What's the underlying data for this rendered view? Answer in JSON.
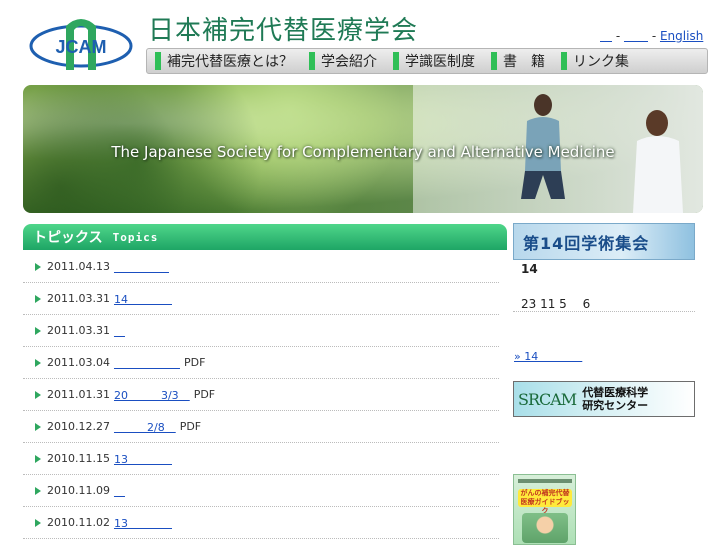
{
  "header": {
    "logo_text": "JCAM",
    "site_title": "日本補完代替医療学会",
    "lang_links": [
      "＿",
      "＿＿",
      "English"
    ],
    "lang_separator": " - "
  },
  "nav": {
    "items": [
      {
        "label": "補完代替医療とは？"
      },
      {
        "label": "学会紹介"
      },
      {
        "label": "学識医制度"
      },
      {
        "label": "書　籍"
      },
      {
        "label": "リンク集"
      }
    ]
  },
  "banner": {
    "text": "The Japanese Society for Complementary and Alternative Medicine"
  },
  "topics": {
    "title_jp": "トピックス",
    "title_en": "Topics",
    "items": [
      {
        "date": "2011.04.13",
        "link": "＿＿＿＿＿",
        "tail": ""
      },
      {
        "date": "2011.03.31",
        "link": "14＿＿＿＿",
        "tail": ""
      },
      {
        "date": "2011.03.31",
        "link": "＿",
        "tail": ""
      },
      {
        "date": "2011.03.04",
        "link": "＿＿＿＿＿＿",
        "tail": "PDF"
      },
      {
        "date": "2011.01.31",
        "link": "20＿＿＿3/3＿",
        "tail": "PDF"
      },
      {
        "date": "2010.12.27",
        "link": "＿＿＿2/8＿",
        "tail": "PDF"
      },
      {
        "date": "2010.11.15",
        "link": "13＿＿＿＿",
        "tail": ""
      },
      {
        "date": "2010.11.09",
        "link": "＿",
        "tail": ""
      },
      {
        "date": "2010.11.02",
        "link": "13＿＿＿＿",
        "tail": ""
      }
    ]
  },
  "sidebar": {
    "conference_banner": "第14回学術集会",
    "conference_number": "14",
    "conference_date": "23 11 5　 6",
    "conference_link": "» 14＿＿＿＿",
    "srcam_logo": "SRCAM",
    "srcam_line1": "代替医療科学",
    "srcam_line2": "研究センター",
    "book_title": "がんの補完代替医療ガイドブック"
  },
  "colors": {
    "brand_green": "#1f7a55",
    "nav_accent": "#2fbf57",
    "topics_header": "#1ea565",
    "link": "#1a4fc1"
  }
}
